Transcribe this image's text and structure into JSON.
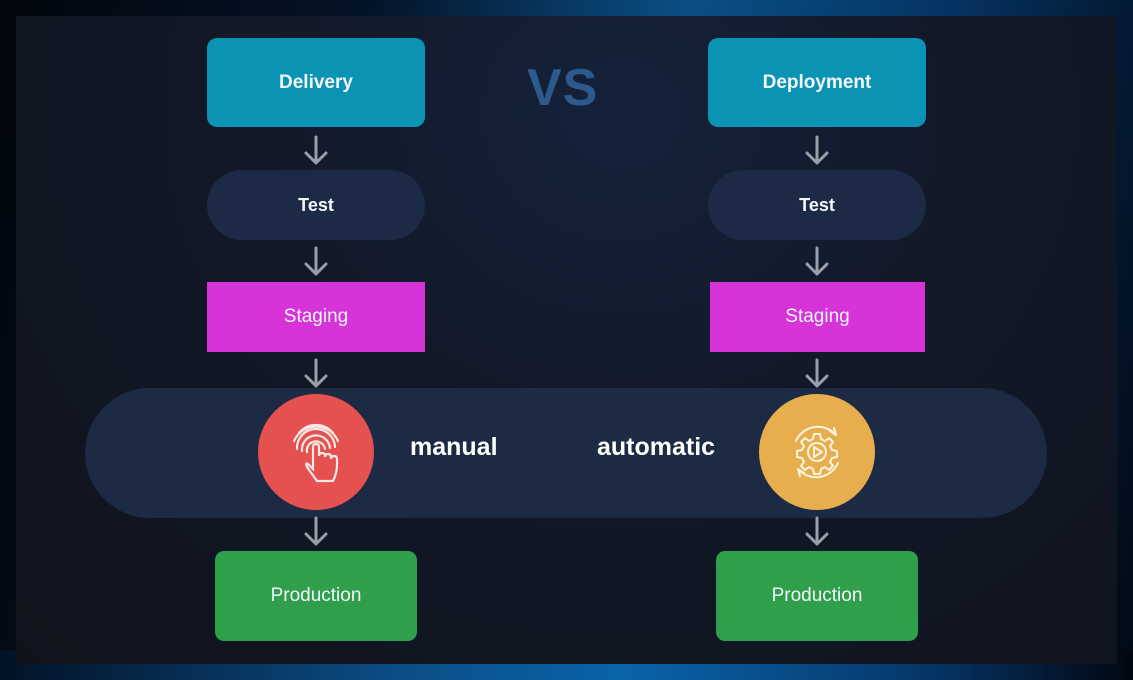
{
  "vs_label": "VS",
  "left_column": {
    "title": "Delivery",
    "steps": [
      "Test",
      "Staging"
    ],
    "mode": "manual",
    "mode_icon": "fingerprint-touch-icon",
    "final": "Production"
  },
  "right_column": {
    "title": "Deployment",
    "steps": [
      "Test",
      "Staging"
    ],
    "mode": "automatic",
    "mode_icon": "gear-cycle-play-icon",
    "final": "Production"
  },
  "colors": {
    "title_box": "#0b93b4",
    "test_pill": "#1d2a45",
    "staging": "#d634d8",
    "manual_circle": "#e5514f",
    "automatic_circle": "#e6ae4c",
    "production": "#2f9f4c",
    "vs_text": "#2c5a8e"
  }
}
